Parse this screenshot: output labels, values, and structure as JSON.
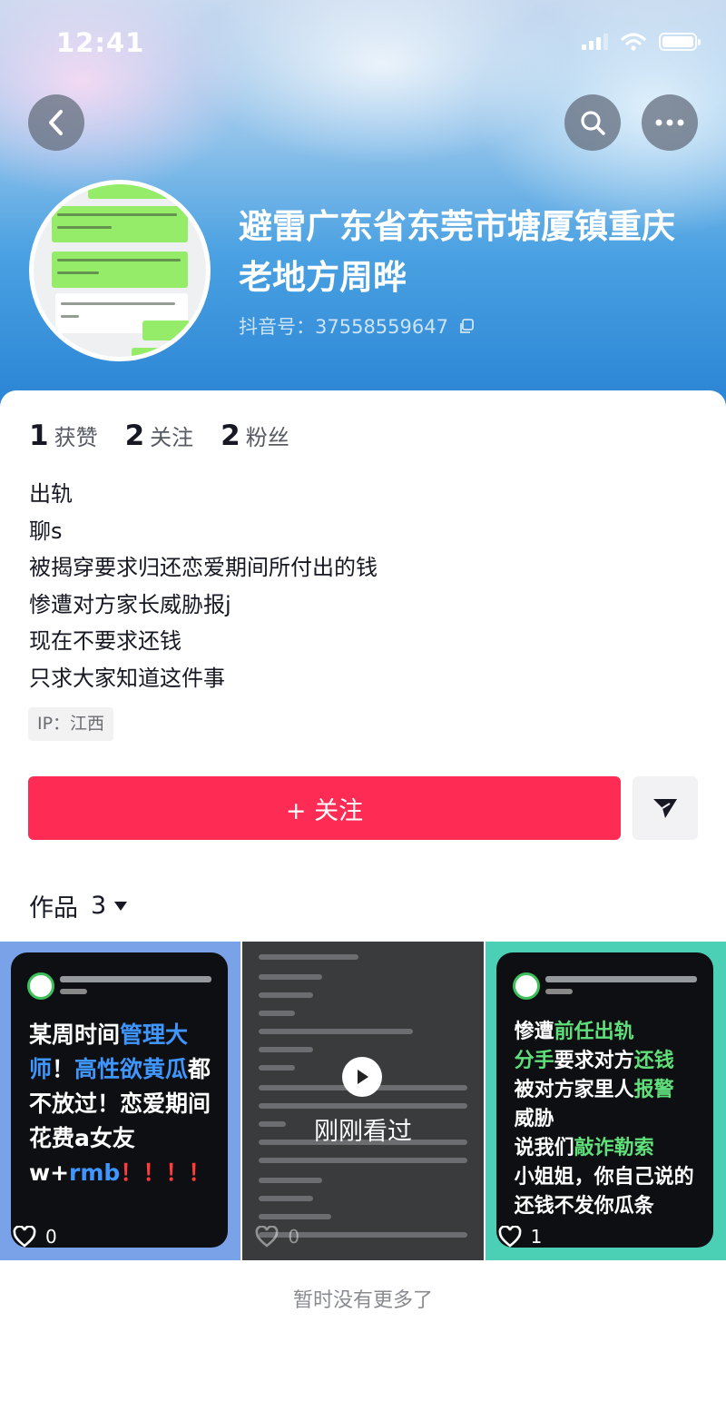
{
  "status_bar": {
    "time": "12:41"
  },
  "profile": {
    "name": "避雷广东省东莞市塘厦镇重庆老地方周晔",
    "douyin_id": "抖音号：37558559647",
    "stats": [
      {
        "count": "1",
        "label": "获赞"
      },
      {
        "count": "2",
        "label": "关注"
      },
      {
        "count": "2",
        "label": "粉丝"
      }
    ],
    "bio_lines": [
      "出轨",
      "聊s",
      "被揭穿要求归还恋爱期间所付出的钱",
      "惨遭对方家长威胁报j",
      "现在不要求还钱",
      "只求大家知道这件事"
    ],
    "ip": "IP：江西"
  },
  "actions": {
    "follow_label": "+ 关注"
  },
  "works": {
    "label": "作品",
    "count": "3",
    "items": [
      {
        "likes": "0"
      },
      {
        "likes": "0",
        "overlay": "刚刚看过"
      },
      {
        "likes": "1"
      }
    ]
  },
  "footer": {
    "no_more": "暂时没有更多了"
  },
  "colors": {
    "accent": "#fe2c55",
    "header_blue": "#2a84d4",
    "chat_green": "#95ec69"
  }
}
